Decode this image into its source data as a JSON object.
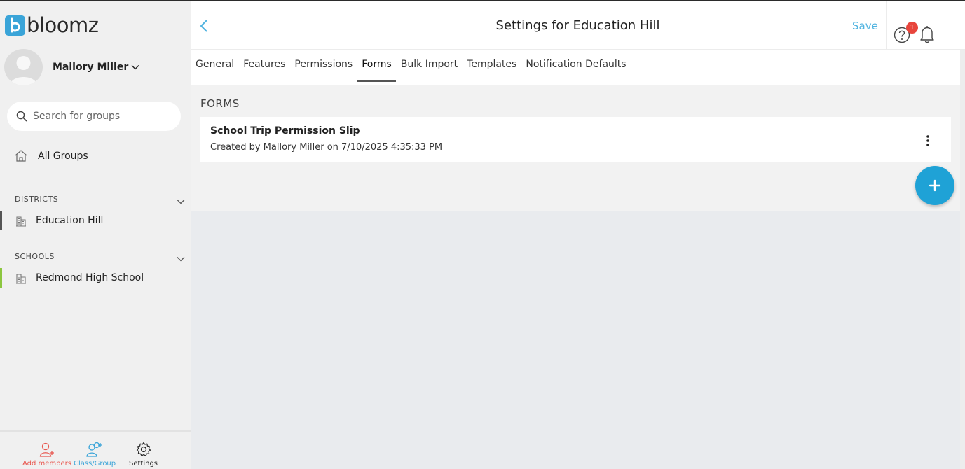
{
  "app": {
    "logo_text": "bloomz",
    "logo_letter": "b"
  },
  "user": {
    "name": "Mallory Miller"
  },
  "sidebar": {
    "search_placeholder": "Search for groups",
    "all_groups_label": "All Groups",
    "sections": [
      {
        "label": "DISTRICTS",
        "items": [
          {
            "label": "Education Hill",
            "accent": "#555555"
          }
        ]
      },
      {
        "label": "SCHOOLS",
        "items": [
          {
            "label": "Redmond High School",
            "accent": "#8cc63f"
          }
        ]
      }
    ],
    "bottom": [
      {
        "label": "Add members",
        "color": "#e8574f",
        "icon": "add-person-icon"
      },
      {
        "label": "Class/Group",
        "color": "#3aa4d8",
        "icon": "group-add-icon"
      },
      {
        "label": "Settings",
        "color": "#222222",
        "icon": "gear-icon"
      }
    ]
  },
  "header": {
    "title": "Settings for Education Hill",
    "save_label": "Save",
    "notification_count": "1"
  },
  "tabs": [
    {
      "label": "General",
      "active": false
    },
    {
      "label": "Features",
      "active": false
    },
    {
      "label": "Permissions",
      "active": false
    },
    {
      "label": "Forms",
      "active": true
    },
    {
      "label": "Bulk Import",
      "active": false
    },
    {
      "label": "Templates",
      "active": false
    },
    {
      "label": "Notification Defaults",
      "active": false
    }
  ],
  "forms": {
    "section_label": "FORMS",
    "items": [
      {
        "title": "School Trip Permission Slip",
        "meta": "Created by Mallory Miller on 7/10/2025 4:35:33 PM"
      }
    ]
  },
  "colors": {
    "accent": "#1fa2d6",
    "save": "#4fb3e0",
    "badge": "#e8453c"
  }
}
